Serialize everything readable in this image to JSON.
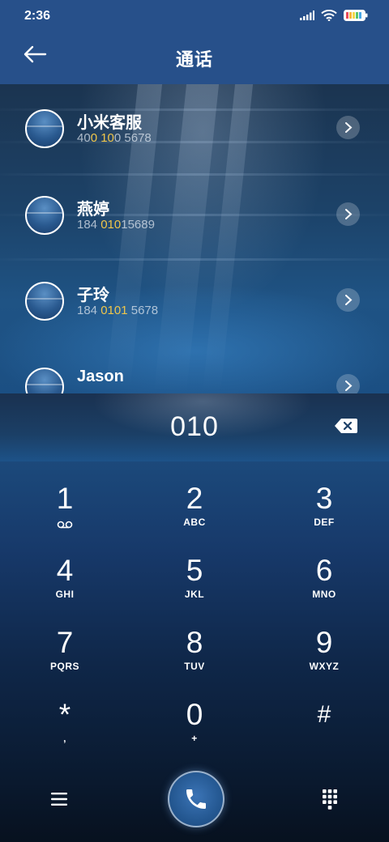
{
  "status_bar": {
    "time": "2:36",
    "signal_icon": "signal-icon",
    "wifi_icon": "wifi-icon",
    "battery_icon": "battery-icon"
  },
  "header": {
    "title": "通话",
    "back_icon": "back-arrow-icon"
  },
  "contacts": [
    {
      "name": "小米客服",
      "number_parts": [
        "40",
        "0 10",
        "0 5678"
      ]
    },
    {
      "name": "燕婷",
      "number_parts": [
        "184 ",
        "010",
        "15689"
      ]
    },
    {
      "name": "子玲",
      "number_parts": [
        "184 ",
        "0101",
        " 5678"
      ]
    },
    {
      "name": "Jason",
      "number_parts": [
        "",
        "",
        ""
      ]
    }
  ],
  "dialer": {
    "number": "010",
    "keys": [
      {
        "digit": "1",
        "letters": "",
        "sub_icon": "voicemail-icon"
      },
      {
        "digit": "2",
        "letters": "ABC"
      },
      {
        "digit": "3",
        "letters": "DEF"
      },
      {
        "digit": "4",
        "letters": "GHI"
      },
      {
        "digit": "5",
        "letters": "JKL"
      },
      {
        "digit": "6",
        "letters": "MNO"
      },
      {
        "digit": "7",
        "letters": "PQRS"
      },
      {
        "digit": "8",
        "letters": "TUV"
      },
      {
        "digit": "9",
        "letters": "WXYZ"
      },
      {
        "digit": "*",
        "letters": ","
      },
      {
        "digit": "0",
        "letters": "+"
      },
      {
        "digit": "#",
        "letters": ""
      }
    ]
  },
  "bottom_bar": {
    "menu_icon": "menu-icon",
    "call_icon": "phone-icon",
    "keypad_icon": "keypad-icon"
  },
  "colors": {
    "header": "#27508a",
    "highlight": "#f0c64a"
  }
}
